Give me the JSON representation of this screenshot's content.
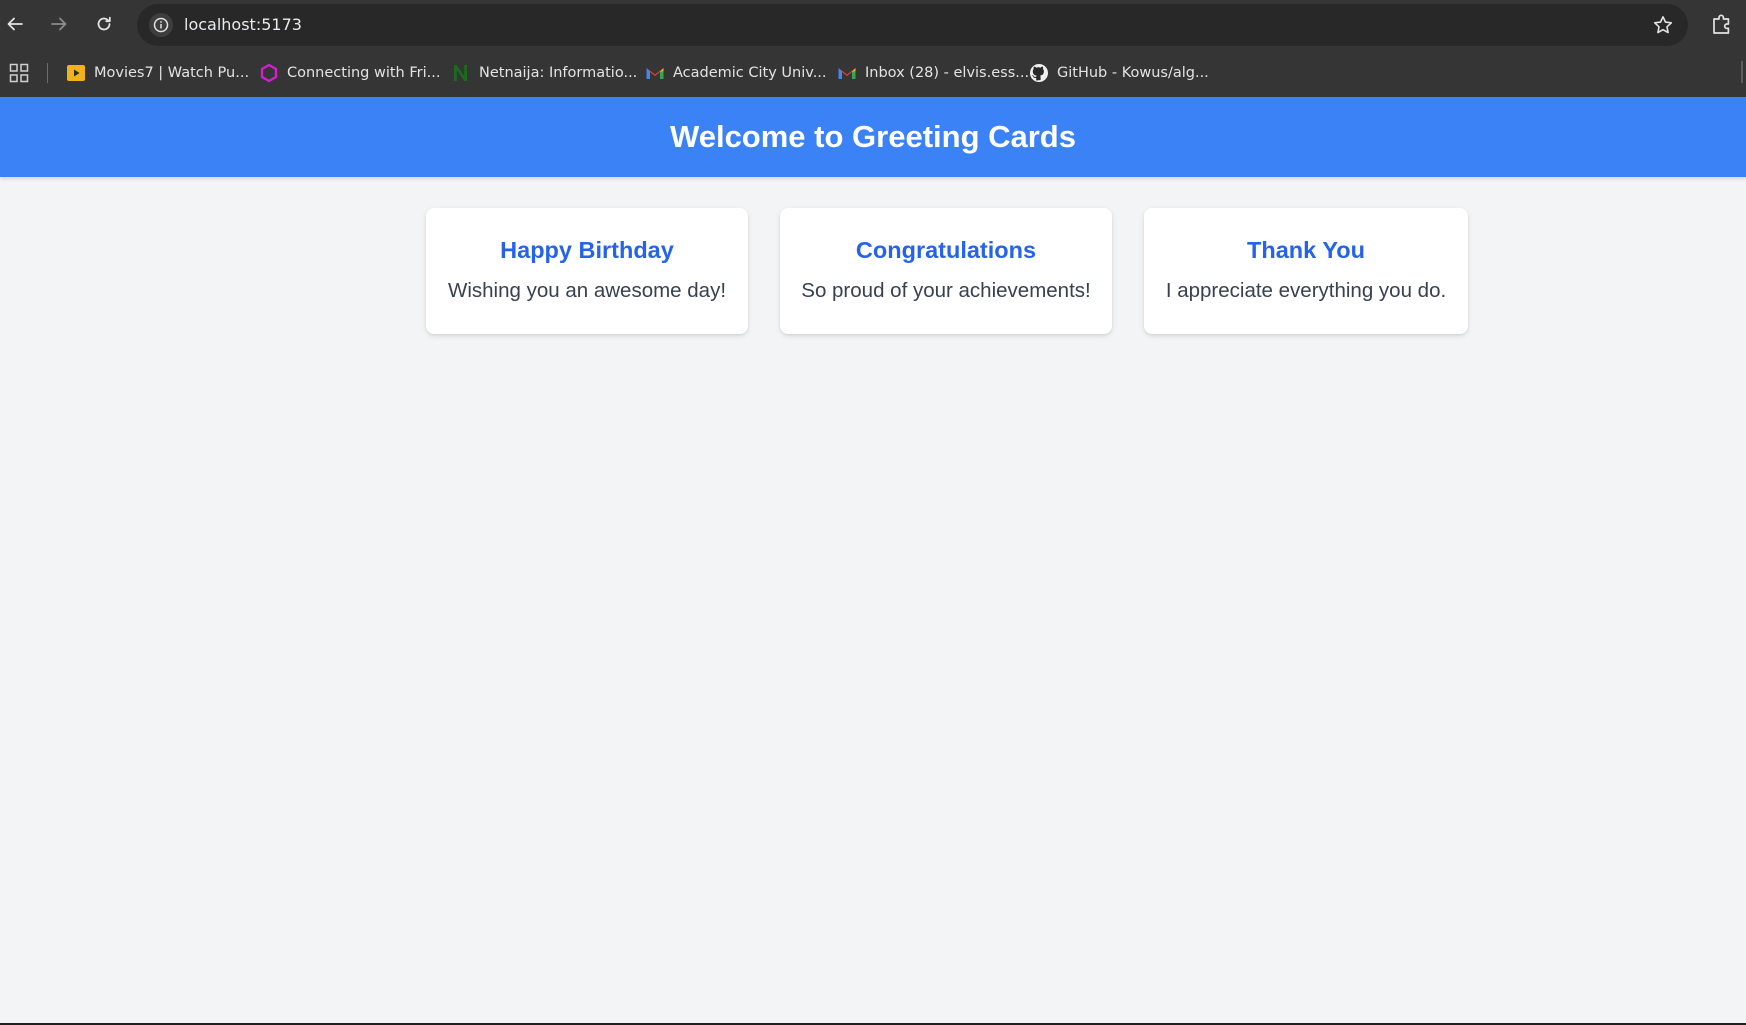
{
  "browser": {
    "url": "localhost:5173",
    "bookmarks": [
      {
        "label": "Movies7 | Watch Pu...",
        "icon": "movies7-favicon-icon"
      },
      {
        "label": "Connecting with Fri...",
        "icon": "ring-favicon-icon"
      },
      {
        "label": "Netnaija: Informatio...",
        "icon": "netnaija-favicon-icon"
      },
      {
        "label": "Academic City Univ...",
        "icon": "gmail-favicon-icon"
      },
      {
        "label": "Inbox (28) - elvis.ess...",
        "icon": "gmail-favicon-icon"
      },
      {
        "label": "GitHub - Kowus/alg...",
        "icon": "github-favicon-icon"
      }
    ]
  },
  "page": {
    "title": "Welcome to Greeting Cards",
    "cards": [
      {
        "title": "Happy Birthday",
        "message": "Wishing you an awesome day!"
      },
      {
        "title": "Congratulations",
        "message": "So proud of your achievements!"
      },
      {
        "title": "Thank You",
        "message": "I appreciate everything you do."
      }
    ]
  },
  "colors": {
    "header_bg": "#3b82f6",
    "card_title": "#2563eb",
    "page_bg": "#f3f4f6",
    "chrome_bg": "#353535"
  }
}
